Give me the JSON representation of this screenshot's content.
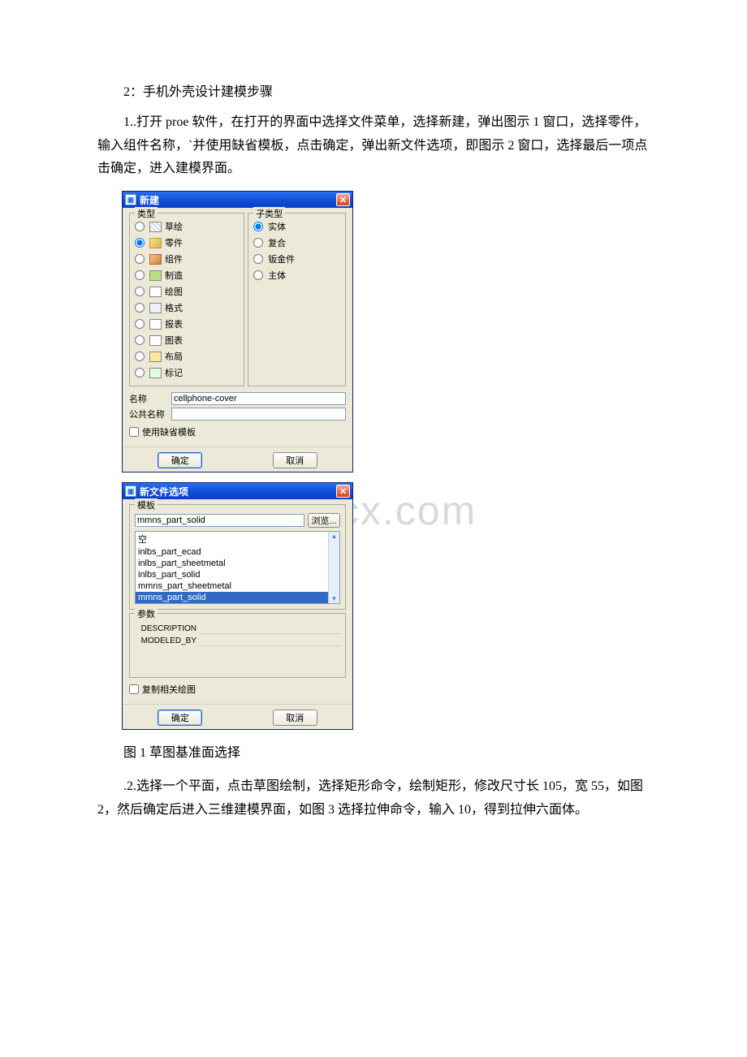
{
  "doc": {
    "heading": "2：手机外壳设计建模步骤",
    "para1": "1..打开 proe 软件，在打开的界面中选择文件菜单，选择新建，弹出图示 1 窗口，选择零件，输入组件名称，`并使用缺省模板，点击确定，弹出新文件选项，即图示 2 窗口，选择最后一项点击确定，进入建模界面。",
    "caption1": "图 1 草图基准面选择",
    "para2": ".2.选择一个平面，点击草图绘制，选择矩形命令，绘制矩形，修改尺寸长 105，宽 55，如图 2，然后确定后进入三维建模界面，如图 3 选择拉伸命令，输入 10，得到拉伸六面体。"
  },
  "watermark": "www.bdocx.com",
  "dialog1": {
    "title": "新建",
    "group_type": "类型",
    "group_subtype": "子类型",
    "types": {
      "sketch": "草绘",
      "part": "零件",
      "asm": "组件",
      "mfg": "制造",
      "drw": "绘图",
      "fmt": "格式",
      "rpt": "报表",
      "dgm": "图表",
      "lay": "布局",
      "mrk": "标记"
    },
    "subtypes": {
      "solid": "实体",
      "composite": "复合",
      "sheetmetal": "钣金件",
      "body": "主体"
    },
    "name_label": "名称",
    "common_name_label": "公共名称",
    "name_value": "cellphone-cover",
    "use_default_template": "使用缺省模板",
    "ok": "确定",
    "cancel": "取消"
  },
  "dialog2": {
    "title": "新文件选项",
    "group_template": "模板",
    "template_value": "mmns_part_solid",
    "browse": "浏览...",
    "list": {
      "empty": "空",
      "i1": "inlbs_part_ecad",
      "i2": "inlbs_part_sheetmetal",
      "i3": "inlbs_part_solid",
      "i4": "mmns_part_sheetmetal",
      "i5": "mmns_part_solid"
    },
    "group_params": "参数",
    "param1": "DESCRIPTION",
    "param2": "MODELED_BY",
    "copy_drawing": "复制相关绘图",
    "ok": "确定",
    "cancel": "取消"
  }
}
